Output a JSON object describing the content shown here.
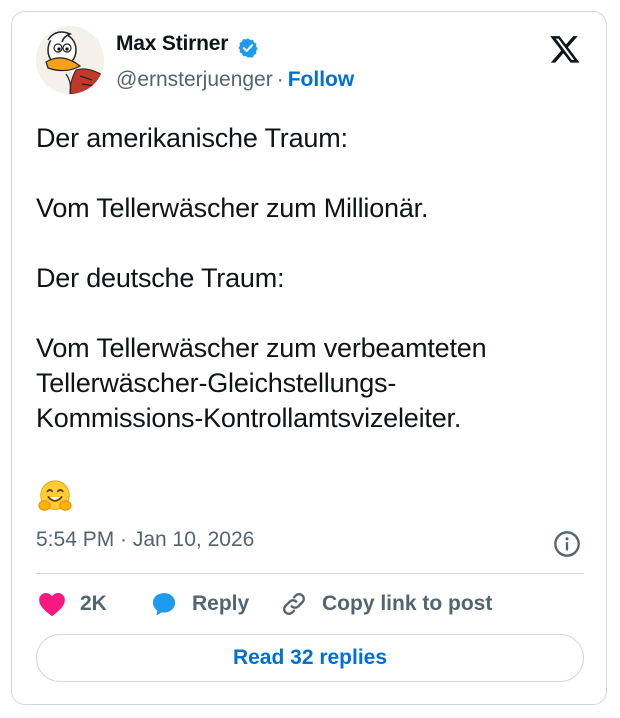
{
  "author": {
    "name": "Max Stirner",
    "handle": "@ernsterjuenger",
    "separator": "·",
    "follow_label": "Follow"
  },
  "tweet": {
    "text": "Der amerikanische Traum:\n\nVom Tellerwäscher zum Millionär.\n\nDer deutsche Traum:\n\nVom Tellerwäscher zum verbeamteten\nTellerwäscher-Gleichstellungs-\nKommissions-Kontrollamtsvizeleiter.",
    "emoji": "hugging-face-emoji",
    "timestamp": "5:54 PM · Jan 10, 2026"
  },
  "actions": {
    "like_count": "2K",
    "reply_label": "Reply",
    "copy_label": "Copy link to post"
  },
  "footer": {
    "read_replies_label": "Read 32 replies"
  },
  "colors": {
    "accent": "#006fd6",
    "like": "#f91880",
    "reply_icon": "#1d9bf0",
    "muted": "#536471",
    "border": "#cfd9de",
    "text": "#0f1419"
  },
  "icons": {
    "avatar": "duck-cartoon-avatar",
    "verified": "verified-badge-icon",
    "platform": "x-logo-icon",
    "info": "info-icon",
    "like": "heart-icon",
    "reply": "speech-bubble-icon",
    "copy": "link-icon"
  }
}
